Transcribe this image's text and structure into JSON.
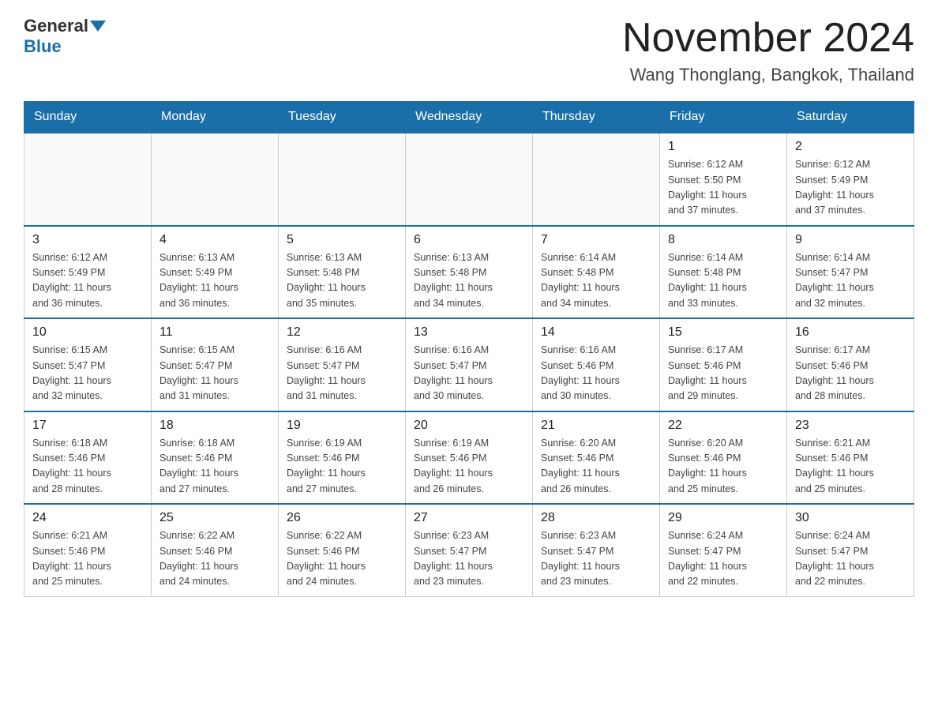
{
  "header": {
    "logo_general": "General",
    "logo_blue": "Blue",
    "title": "November 2024",
    "subtitle": "Wang Thonglang, Bangkok, Thailand"
  },
  "days_of_week": [
    "Sunday",
    "Monday",
    "Tuesday",
    "Wednesday",
    "Thursday",
    "Friday",
    "Saturday"
  ],
  "weeks": [
    [
      {
        "day": "",
        "info": ""
      },
      {
        "day": "",
        "info": ""
      },
      {
        "day": "",
        "info": ""
      },
      {
        "day": "",
        "info": ""
      },
      {
        "day": "",
        "info": ""
      },
      {
        "day": "1",
        "info": "Sunrise: 6:12 AM\nSunset: 5:50 PM\nDaylight: 11 hours\nand 37 minutes."
      },
      {
        "day": "2",
        "info": "Sunrise: 6:12 AM\nSunset: 5:49 PM\nDaylight: 11 hours\nand 37 minutes."
      }
    ],
    [
      {
        "day": "3",
        "info": "Sunrise: 6:12 AM\nSunset: 5:49 PM\nDaylight: 11 hours\nand 36 minutes."
      },
      {
        "day": "4",
        "info": "Sunrise: 6:13 AM\nSunset: 5:49 PM\nDaylight: 11 hours\nand 36 minutes."
      },
      {
        "day": "5",
        "info": "Sunrise: 6:13 AM\nSunset: 5:48 PM\nDaylight: 11 hours\nand 35 minutes."
      },
      {
        "day": "6",
        "info": "Sunrise: 6:13 AM\nSunset: 5:48 PM\nDaylight: 11 hours\nand 34 minutes."
      },
      {
        "day": "7",
        "info": "Sunrise: 6:14 AM\nSunset: 5:48 PM\nDaylight: 11 hours\nand 34 minutes."
      },
      {
        "day": "8",
        "info": "Sunrise: 6:14 AM\nSunset: 5:48 PM\nDaylight: 11 hours\nand 33 minutes."
      },
      {
        "day": "9",
        "info": "Sunrise: 6:14 AM\nSunset: 5:47 PM\nDaylight: 11 hours\nand 32 minutes."
      }
    ],
    [
      {
        "day": "10",
        "info": "Sunrise: 6:15 AM\nSunset: 5:47 PM\nDaylight: 11 hours\nand 32 minutes."
      },
      {
        "day": "11",
        "info": "Sunrise: 6:15 AM\nSunset: 5:47 PM\nDaylight: 11 hours\nand 31 minutes."
      },
      {
        "day": "12",
        "info": "Sunrise: 6:16 AM\nSunset: 5:47 PM\nDaylight: 11 hours\nand 31 minutes."
      },
      {
        "day": "13",
        "info": "Sunrise: 6:16 AM\nSunset: 5:47 PM\nDaylight: 11 hours\nand 30 minutes."
      },
      {
        "day": "14",
        "info": "Sunrise: 6:16 AM\nSunset: 5:46 PM\nDaylight: 11 hours\nand 30 minutes."
      },
      {
        "day": "15",
        "info": "Sunrise: 6:17 AM\nSunset: 5:46 PM\nDaylight: 11 hours\nand 29 minutes."
      },
      {
        "day": "16",
        "info": "Sunrise: 6:17 AM\nSunset: 5:46 PM\nDaylight: 11 hours\nand 28 minutes."
      }
    ],
    [
      {
        "day": "17",
        "info": "Sunrise: 6:18 AM\nSunset: 5:46 PM\nDaylight: 11 hours\nand 28 minutes."
      },
      {
        "day": "18",
        "info": "Sunrise: 6:18 AM\nSunset: 5:46 PM\nDaylight: 11 hours\nand 27 minutes."
      },
      {
        "day": "19",
        "info": "Sunrise: 6:19 AM\nSunset: 5:46 PM\nDaylight: 11 hours\nand 27 minutes."
      },
      {
        "day": "20",
        "info": "Sunrise: 6:19 AM\nSunset: 5:46 PM\nDaylight: 11 hours\nand 26 minutes."
      },
      {
        "day": "21",
        "info": "Sunrise: 6:20 AM\nSunset: 5:46 PM\nDaylight: 11 hours\nand 26 minutes."
      },
      {
        "day": "22",
        "info": "Sunrise: 6:20 AM\nSunset: 5:46 PM\nDaylight: 11 hours\nand 25 minutes."
      },
      {
        "day": "23",
        "info": "Sunrise: 6:21 AM\nSunset: 5:46 PM\nDaylight: 11 hours\nand 25 minutes."
      }
    ],
    [
      {
        "day": "24",
        "info": "Sunrise: 6:21 AM\nSunset: 5:46 PM\nDaylight: 11 hours\nand 25 minutes."
      },
      {
        "day": "25",
        "info": "Sunrise: 6:22 AM\nSunset: 5:46 PM\nDaylight: 11 hours\nand 24 minutes."
      },
      {
        "day": "26",
        "info": "Sunrise: 6:22 AM\nSunset: 5:46 PM\nDaylight: 11 hours\nand 24 minutes."
      },
      {
        "day": "27",
        "info": "Sunrise: 6:23 AM\nSunset: 5:47 PM\nDaylight: 11 hours\nand 23 minutes."
      },
      {
        "day": "28",
        "info": "Sunrise: 6:23 AM\nSunset: 5:47 PM\nDaylight: 11 hours\nand 23 minutes."
      },
      {
        "day": "29",
        "info": "Sunrise: 6:24 AM\nSunset: 5:47 PM\nDaylight: 11 hours\nand 22 minutes."
      },
      {
        "day": "30",
        "info": "Sunrise: 6:24 AM\nSunset: 5:47 PM\nDaylight: 11 hours\nand 22 minutes."
      }
    ]
  ]
}
